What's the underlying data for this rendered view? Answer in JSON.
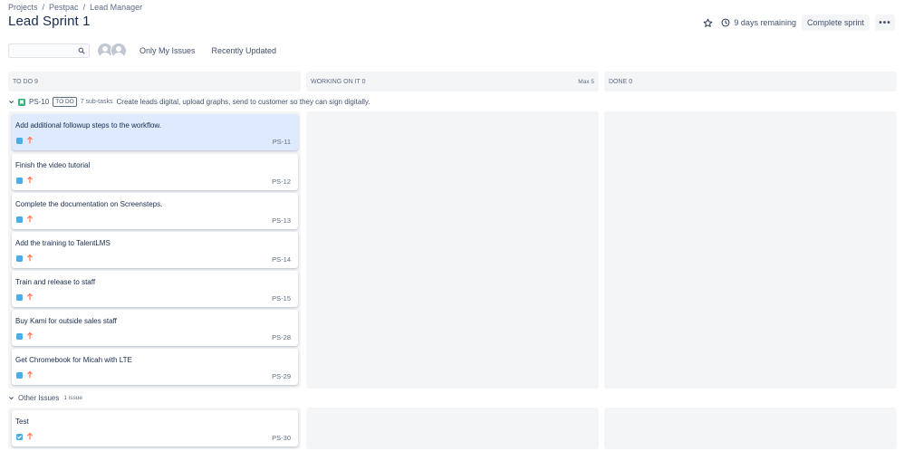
{
  "breadcrumb": {
    "projects": "Projects",
    "project": "Pestpac",
    "board": "Lead Manager"
  },
  "page_title": "Lead Sprint 1",
  "header": {
    "remaining": "9 days remaining",
    "complete_sprint": "Complete sprint",
    "more": "•••"
  },
  "filters": {
    "search_placeholder": "",
    "only_my_issues": "Only My Issues",
    "recently_updated": "Recently Updated"
  },
  "columns": [
    {
      "name": "TO DO",
      "count": "9",
      "max": ""
    },
    {
      "name": "WORKING ON IT",
      "count": "0",
      "max": "Max 5"
    },
    {
      "name": "DONE",
      "count": "0",
      "max": ""
    }
  ],
  "swimlane_parent": {
    "key": "PS-10",
    "status": "TO DO",
    "subtasks": "7 sub-tasks",
    "summary": "Create leads digital, upload graphs, send to customer so they can sign digitally."
  },
  "swimlane_other": {
    "label": "Other Issues",
    "count": "1 issue"
  },
  "cards": [
    {
      "summary": "Add additional followup steps to the workflow.",
      "key": "PS-11",
      "type": "subtask",
      "selected": true
    },
    {
      "summary": "Finish the video tutorial",
      "key": "PS-12",
      "type": "subtask"
    },
    {
      "summary": "Complete the documentation on Screensteps.",
      "key": "PS-13",
      "type": "subtask"
    },
    {
      "summary": "Add the training to TalentLMS",
      "key": "PS-14",
      "type": "subtask"
    },
    {
      "summary": "Train and release to staff",
      "key": "PS-15",
      "type": "subtask"
    },
    {
      "summary": "Buy Kami for outside sales staff",
      "key": "PS-28",
      "type": "subtask"
    },
    {
      "summary": "Get Chromebook for Micah with LTE",
      "key": "PS-29",
      "type": "subtask"
    },
    {
      "summary": "Test",
      "key": "PS-30",
      "type": "task"
    }
  ],
  "icons": {
    "star": "star-icon",
    "clock": "clock-icon",
    "search": "search-icon",
    "priority": "arrow-up-icon",
    "subtask": "subtask-icon",
    "task": "task-checkbox-icon"
  },
  "colors": {
    "accent": "#0052cc",
    "column_bg": "#f4f5f7",
    "selected_card": "#deebff",
    "priority": "#ff7452",
    "subtask_icon": "#4bade8",
    "story_icon": "#36b37e"
  }
}
